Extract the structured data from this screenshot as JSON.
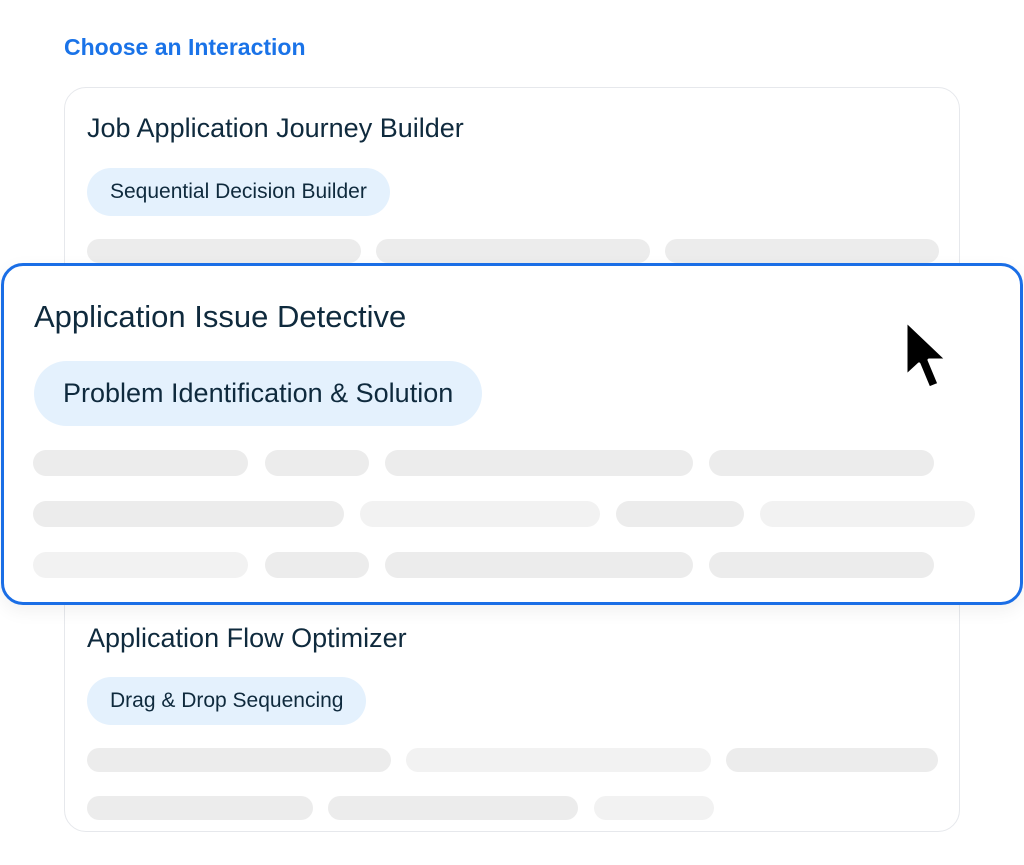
{
  "heading": "Choose an Interaction",
  "cards": [
    {
      "title": "Job Application Journey Builder",
      "tag": "Sequential Decision Builder"
    },
    {
      "title": "Application Issue Detective",
      "tag": "Problem Identification & Solution",
      "selected": true
    },
    {
      "title": "Application Flow Optimizer",
      "tag": "Drag & Drop Sequencing"
    }
  ],
  "cursor_icon": "pointer-arrow-icon",
  "colors": {
    "accent": "#1a6ee6",
    "heading": "#1a73e8",
    "tag_background": "#e4f1fd",
    "text": "#0f2a3d",
    "skeleton": "#ececec"
  }
}
